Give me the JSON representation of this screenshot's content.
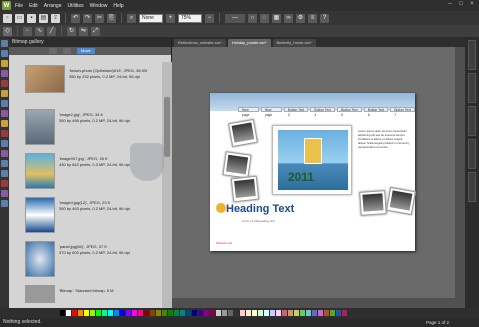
{
  "menu": [
    "File",
    "Edit",
    "Arrange",
    "Utilities",
    "Window",
    "Help"
  ],
  "toolbar": {
    "zoom_mode": "None",
    "zoom": "75%"
  },
  "gallery": {
    "title": "Bitmap gallery",
    "tabs": [
      "",
      "",
      "Move"
    ],
    "items": [
      {
        "name": "'beach-photo (Optimised)013', JPEG, 38 KB",
        "detail": "350 by 232 pixels, 0.2 MP, 24-bit, 96 dpi",
        "color": "#b88a5a"
      },
      {
        "name": "'image2.jpg', JPEG, 34 K",
        "detail": "350 by 496 pixels, 0.2 MP, 24-bit, 96 dpi",
        "color": "#7a8a9a"
      },
      {
        "name": "'image007.jpg', JPEG, 26 K",
        "detail": "430 by 642 pixels, 0.3 MP, 24-bit, 96 dpi",
        "color": "#3a8ac0"
      },
      {
        "name": "'image4.jpg(12)', JPEG, 23 K",
        "detail": "350 by 463 pixels, 0.2 MP, 24-bit, 96 dpi",
        "color": "#2a5a9a"
      },
      {
        "name": "'panel.jpg(84)', JPEG, 37 K",
        "detail": "370 by 600 pixels, 0.2 MP, 24-bit, 96 dpi",
        "color": "#4a7ab0"
      },
      {
        "name": "'Bitmap', Standard bitmap, 5 M",
        "detail": "",
        "color": "#888"
      }
    ]
  },
  "doc_tabs": [
    "Reflections_website.xar*",
    "Holiday_poster.xar*",
    "Butterfly_home.xar*"
  ],
  "page": {
    "nav": [
      "New page",
      "New page",
      "Button Text 3",
      "Button Text 4",
      "Button Text 5",
      "Button Text 6",
      "Button Text 7"
    ],
    "year": "2011",
    "heading": "Heading Text",
    "subheading": "A line of subheading text",
    "link": "Website link",
    "body": "Lorem ipsum dolor sit amet consectetur adipiscing elit sed do eiusmod tempor incididunt ut labore et dolore magna aliqua. Nulla feugiat proident in nonummy reprehenderit commodo."
  },
  "status": {
    "left": "Nothing selected.",
    "page": "Page 1 of 2"
  },
  "colors": {
    "accent": "#4a8ad0"
  }
}
